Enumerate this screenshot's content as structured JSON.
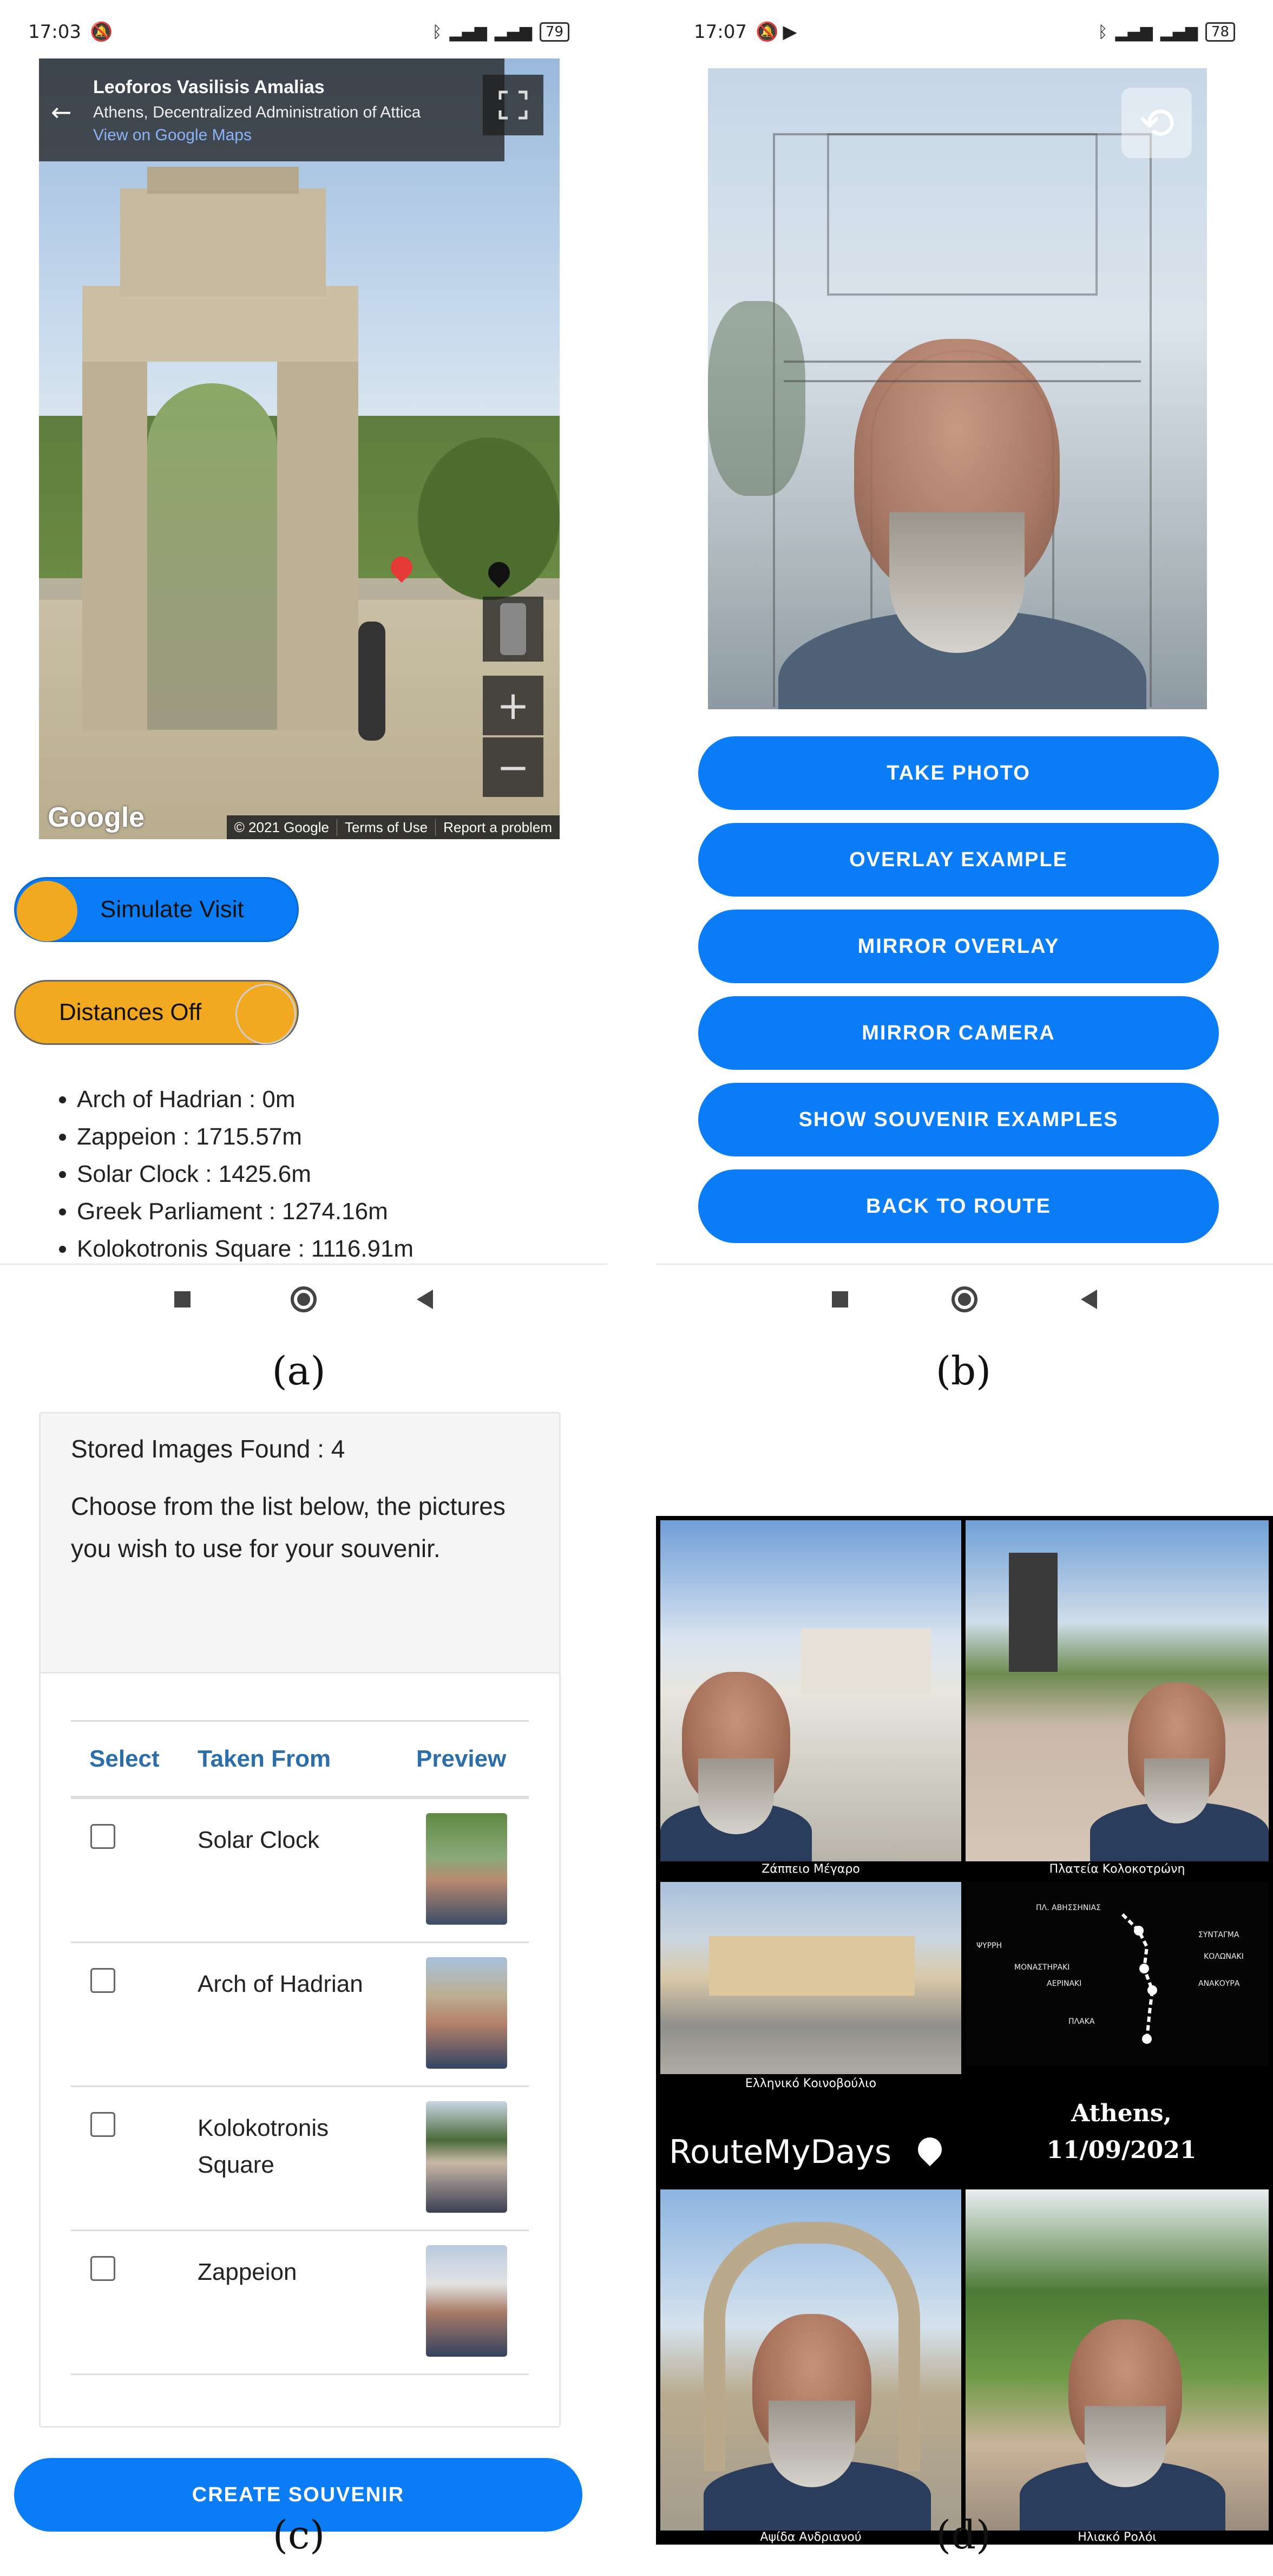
{
  "panel_labels": {
    "a": "(a)",
    "b": "(b)",
    "c": "(c)",
    "d": "(d)"
  },
  "panel_a": {
    "status_time": "17:03",
    "battery": "79",
    "streetview": {
      "title": "Leoforos Vasilisis Amalias",
      "subtitle": "Athens, Decentralized Administration of Attica",
      "link": "View on Google Maps",
      "google_logo": "Google",
      "copyright": "© 2021 Google",
      "terms": "Terms of Use",
      "report": "Report a problem"
    },
    "simulate_toggle": "Simulate Visit",
    "distances_toggle": "Distances Off",
    "distances": [
      "Arch of Hadrian : 0m",
      "Zappeion : 1715.57m",
      "Solar Clock : 1425.6m",
      "Greek Parliament : 1274.16m",
      "Kolokotronis Square : 1116.91m"
    ]
  },
  "panel_b": {
    "status_time": "17:07",
    "battery": "78",
    "buttons": [
      "TAKE PHOTO",
      "OVERLAY EXAMPLE",
      "MIRROR OVERLAY",
      "MIRROR CAMERA",
      "SHOW SOUVENIR EXAMPLES",
      "BACK TO ROUTE"
    ]
  },
  "panel_c": {
    "found": "Stored Images Found : 4",
    "instructions": "Choose from the list below, the pictures you wish to use for your souvenir.",
    "headers": {
      "select": "Select",
      "taken_from": "Taken From",
      "preview": "Preview"
    },
    "rows": [
      {
        "place": "Solar Clock"
      },
      {
        "place": "Arch of Hadrian"
      },
      {
        "place": "Kolokotronis Square"
      },
      {
        "place": "Zappeion"
      }
    ],
    "create_button": "CREATE SOUVENIR"
  },
  "panel_d": {
    "captions": {
      "zappeion": "Ζάππειο Μέγαρο",
      "kolokotroni": "Πλατεία Κολοκοτρώνη",
      "parliament": "Ελληνικό Κοινοβούλιο",
      "hadrian": "Αψίδα Ανδριανού",
      "clock": "Ηλιακό Ρολόι"
    },
    "brand": "RouteMyDays",
    "city": "Athens,",
    "date": "11/09/2021",
    "map_labels": [
      "ΠΛ. ΑΒΗΣΣΗΝΙΑΣ",
      "ΨΥΡΡΗ",
      "ΜΟΝΑΣΤΗΡΑΚΙ",
      "ΑΕΡΙΝΑΚΙ",
      "ΠΛΑΚΑ",
      "ΑΝΑΚΟΥΡΑ",
      "ΚΟΛΩΝΑΚΙ",
      "ΣΥΝΤΑΓΜΑ"
    ]
  },
  "colors": {
    "primary_blue": "#0a7cf5",
    "toggle_orange": "#f2a91f"
  }
}
